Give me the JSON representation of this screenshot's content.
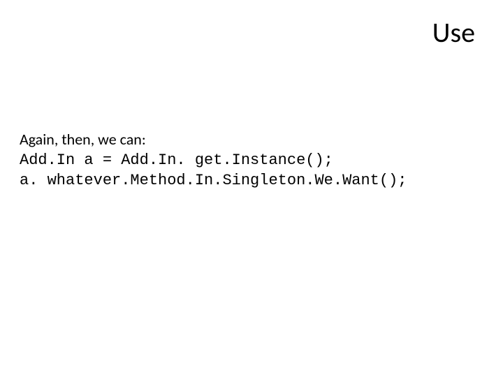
{
  "title": "Use",
  "body": {
    "intro": "Again, then, we can:",
    "code_line_1": "Add.In a = Add.In. get.Instance();",
    "code_line_2": "a. whatever.Method.In.Singleton.We.Want();"
  }
}
